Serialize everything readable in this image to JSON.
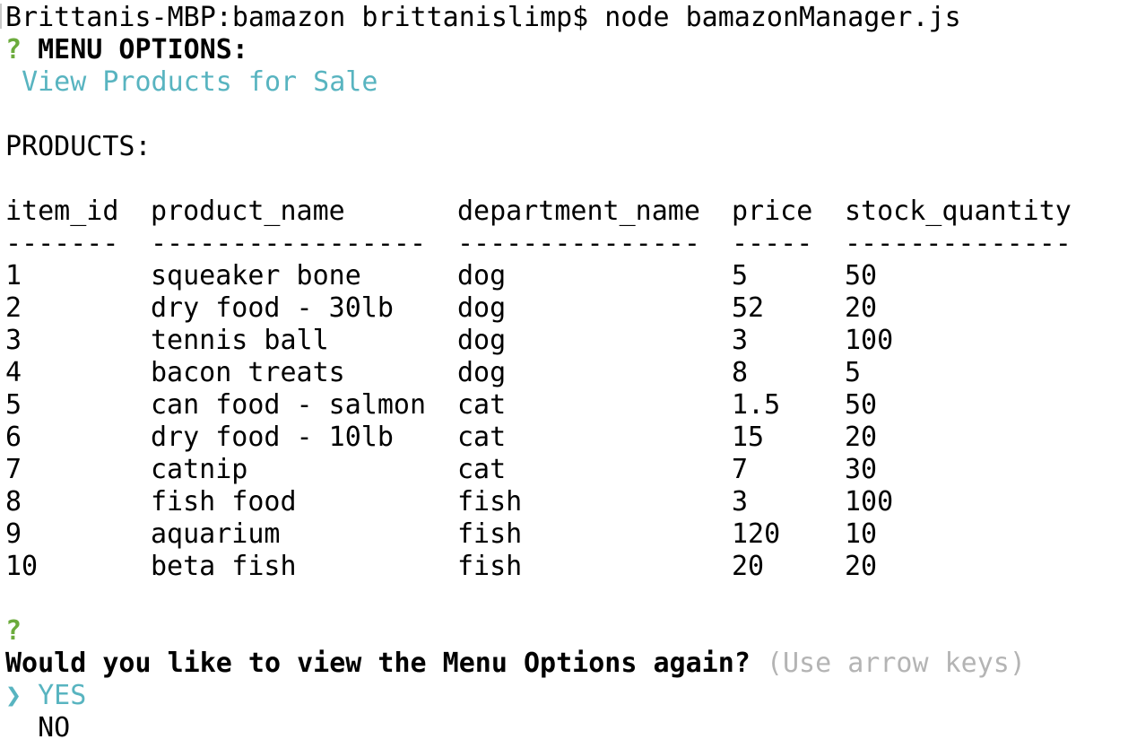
{
  "terminal": {
    "prompt": "Brittanis-MBP:bamazon brittanislimp$ node bamazonManager.js",
    "menu": {
      "question_mark": "?",
      "label": "MENU OPTIONS:",
      "answer": "View Products for Sale"
    },
    "products_heading": "PRODUCTS:",
    "table": {
      "columns": [
        "item_id",
        "product_name",
        "department_name",
        "price",
        "stock_quantity"
      ],
      "separators": [
        "-------",
        "-----------------",
        "---------------",
        "-----",
        "--------------"
      ],
      "rows": [
        [
          "1",
          "squeaker bone",
          "dog",
          "5",
          "50"
        ],
        [
          "2",
          "dry food - 30lb",
          "dog",
          "52",
          "20"
        ],
        [
          "3",
          "tennis ball",
          "dog",
          "3",
          "100"
        ],
        [
          "4",
          "bacon treats",
          "dog",
          "8",
          "5"
        ],
        [
          "5",
          "can food - salmon",
          "cat",
          "1.5",
          "50"
        ],
        [
          "6",
          "dry food - 10lb",
          "cat",
          "15",
          "20"
        ],
        [
          "7",
          "catnip",
          "cat",
          "7",
          "30"
        ],
        [
          "8",
          "fish food",
          "fish",
          "3",
          "100"
        ],
        [
          "9",
          "aquarium",
          "fish",
          "120",
          "10"
        ],
        [
          "10",
          "beta fish",
          "fish",
          "20",
          "20"
        ]
      ]
    },
    "followup": {
      "question_mark": "?",
      "question": "Would you like to view the Menu Options again?",
      "hint": "(Use arrow keys)",
      "pointer": "❯",
      "options": [
        "YES",
        "NO"
      ],
      "selected": "YES"
    },
    "colors": {
      "question_mark": "#6cab3c",
      "highlight": "#58b4c0",
      "hint": "#b4b4b4",
      "text": "#000000",
      "background": "#ffffff"
    }
  }
}
